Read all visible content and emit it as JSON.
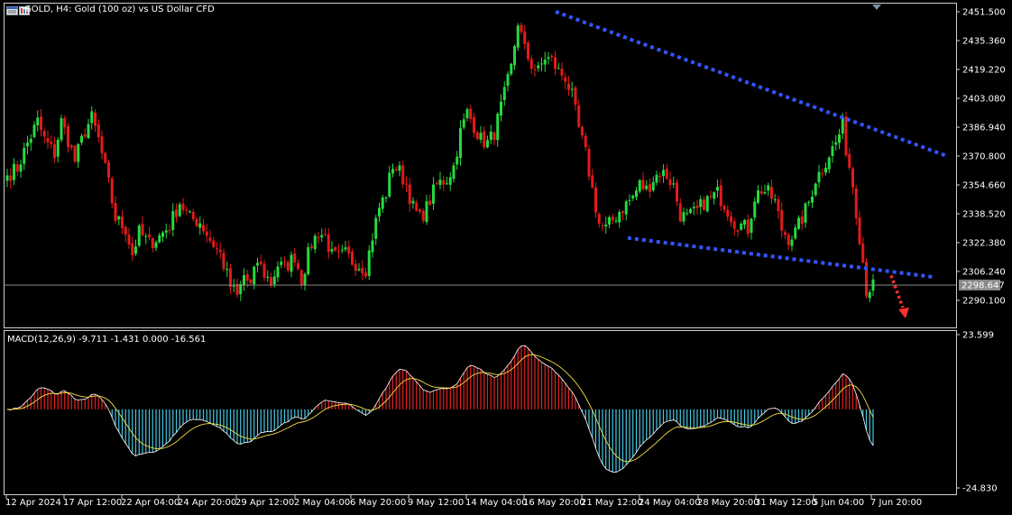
{
  "header": {
    "title": "GOLD, H4:  Gold (100 oz) vs US Dollar CFD"
  },
  "icons": [
    "chart-window-icon",
    "chart-window-icon"
  ],
  "macd_header": "MACD(12,26,9) -9.711 -1.431 0.000 -16.561",
  "colors": {
    "background": "#000000",
    "bull": "#26d93f",
    "bear": "#e31a1a",
    "trend": "#3355ff",
    "arrow": "#ff3030",
    "macd_hist_pos": "#e52222",
    "macd_hist_neg": "#45c8e5",
    "macd_line": "#ffffff",
    "signal_line": "#f5e03a"
  },
  "chart_data": [
    {
      "type": "candlestick",
      "symbol": "GOLD",
      "timeframe": "H4",
      "ylim": [
        2282,
        2455
      ],
      "y_ticks": [
        "2451.500",
        "2435.360",
        "2419.220",
        "2403.080",
        "2386.940",
        "2370.800",
        "2354.660",
        "2338.520",
        "2322.380",
        "2306.240",
        "2290.100"
      ],
      "last_price": 2298.647,
      "last_price_label": "2298.647",
      "x_ticks": [
        "12 Apr 2024",
        "17 Apr 12:00",
        "22 Apr 04:00",
        "24 Apr 20:00",
        "29 Apr 12:00",
        "2 May 04:00",
        "6 May 20:00",
        "9 May 12:00",
        "14 May 04:00",
        "16 May 20:00",
        "21 May 12:00",
        "24 May 04:00",
        "28 May 20:00",
        "31 May 12:00",
        "5 Jun 04:00",
        "7 Jun 20:00"
      ],
      "anchors": [
        [
          0,
          2360
        ],
        [
          3,
          2364
        ],
        [
          6,
          2378
        ],
        [
          9,
          2390
        ],
        [
          11,
          2380
        ],
        [
          14,
          2372
        ],
        [
          16,
          2390
        ],
        [
          18,
          2380
        ],
        [
          20,
          2368
        ],
        [
          23,
          2385
        ],
        [
          25,
          2392
        ],
        [
          27,
          2380
        ],
        [
          30,
          2355
        ],
        [
          32,
          2336
        ],
        [
          35,
          2330
        ],
        [
          37,
          2316
        ],
        [
          39,
          2328
        ],
        [
          42,
          2322
        ],
        [
          45,
          2326
        ],
        [
          48,
          2332
        ],
        [
          51,
          2345
        ],
        [
          54,
          2336
        ],
        [
          57,
          2334
        ],
        [
          60,
          2324
        ],
        [
          63,
          2316
        ],
        [
          66,
          2298
        ],
        [
          68,
          2292
        ],
        [
          70,
          2304
        ],
        [
          72,
          2298
        ],
        [
          74,
          2312
        ],
        [
          76,
          2305
        ],
        [
          78,
          2300
        ],
        [
          80,
          2310
        ],
        [
          82,
          2308
        ],
        [
          85,
          2315
        ],
        [
          87,
          2302
        ],
        [
          90,
          2322
        ],
        [
          92,
          2328
        ],
        [
          94,
          2326
        ],
        [
          96,
          2315
        ],
        [
          98,
          2314
        ],
        [
          100,
          2316
        ],
        [
          102,
          2312
        ],
        [
          104,
          2310
        ],
        [
          106,
          2308
        ],
        [
          108,
          2326
        ],
        [
          110,
          2342
        ],
        [
          112,
          2350
        ],
        [
          114,
          2366
        ],
        [
          116,
          2362
        ],
        [
          118,
          2355
        ],
        [
          120,
          2342
        ],
        [
          122,
          2336
        ],
        [
          124,
          2342
        ],
        [
          127,
          2355
        ],
        [
          130,
          2358
        ],
        [
          132,
          2365
        ],
        [
          134,
          2384
        ],
        [
          136,
          2395
        ],
        [
          138,
          2388
        ],
        [
          140,
          2380
        ],
        [
          142,
          2378
        ],
        [
          144,
          2384
        ],
        [
          147,
          2405
        ],
        [
          149,
          2420
        ],
        [
          151,
          2446
        ],
        [
          153,
          2430
        ],
        [
          155,
          2422
        ],
        [
          157,
          2418
        ],
        [
          159,
          2426
        ],
        [
          161,
          2424
        ],
        [
          163,
          2418
        ],
        [
          165,
          2415
        ],
        [
          167,
          2404
        ],
        [
          169,
          2386
        ],
        [
          171,
          2372
        ],
        [
          173,
          2352
        ],
        [
          175,
          2333
        ],
        [
          177,
          2330
        ],
        [
          179,
          2335
        ],
        [
          181,
          2340
        ],
        [
          183,
          2344
        ],
        [
          185,
          2348
        ],
        [
          187,
          2355
        ],
        [
          189,
          2352
        ],
        [
          191,
          2358
        ],
        [
          193,
          2362
        ],
        [
          195,
          2360
        ],
        [
          197,
          2354
        ],
        [
          199,
          2338
        ],
        [
          201,
          2336
        ],
        [
          204,
          2340
        ],
        [
          206,
          2345
        ],
        [
          208,
          2347
        ],
        [
          210,
          2350
        ],
        [
          212,
          2344
        ],
        [
          215,
          2334
        ],
        [
          217,
          2332
        ],
        [
          219,
          2330
        ],
        [
          221,
          2348
        ],
        [
          223,
          2352
        ],
        [
          225,
          2350
        ],
        [
          227,
          2345
        ],
        [
          229,
          2330
        ],
        [
          231,
          2325
        ],
        [
          233,
          2328
        ],
        [
          235,
          2336
        ],
        [
          237,
          2345
        ],
        [
          239,
          2358
        ],
        [
          241,
          2364
        ],
        [
          243,
          2372
        ],
        [
          245,
          2378
        ],
        [
          247,
          2388
        ],
        [
          248,
          2375
        ],
        [
          250,
          2355
        ],
        [
          252,
          2326
        ],
        [
          253,
          2312
        ],
        [
          254,
          2296
        ],
        [
          256,
          2298
        ]
      ]
    },
    {
      "type": "macd",
      "name": "MACD(12,26,9)",
      "values": {
        "macd": -9.711,
        "signal": -1.431,
        "extra": 0.0,
        "hist_low": -16.561
      },
      "ylim": [
        -24.83,
        23.599
      ],
      "y_ticks": [
        "23.599",
        "-24.830"
      ]
    }
  ]
}
